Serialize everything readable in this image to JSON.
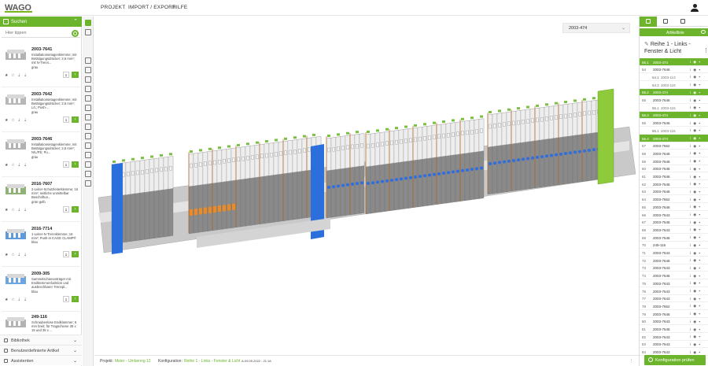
{
  "header": {
    "logo": "WAGO",
    "nav": [
      "PROJEKT",
      "IMPORT / EXPORT",
      "HILFE"
    ]
  },
  "left": {
    "title": "Suchen",
    "search_placeholder": "Hier tippen",
    "products": [
      {
        "code": "2003-7641",
        "desc": "Installationsetagenklemme; mit Betätigungsdrücker; 2,5 mm²; mit N-Trenn...",
        "color": "grau",
        "qty": "1"
      },
      {
        "code": "2003-7642",
        "desc": "Installationsetagenklemme; mit Betätigungsdrücker; 2,5 mm²; L/L; Push-...",
        "color": "grau",
        "qty": "1"
      },
      {
        "code": "2003-7646",
        "desc": "Installationsetagenklemme; mit Betätigungsdrücker; 2,5 mm²; N/L/PE; Pu...",
        "color": "grau",
        "qty": "1"
      },
      {
        "code": "2016-7607",
        "desc": "2-Leiter-Schutzleiterklemme; 16 mm²; seitliche unmittelbar Beschriftun...",
        "color": "grün-gelb",
        "qty": "1"
      },
      {
        "code": "2016-7714",
        "desc": "1-Leiter-N-Trennklemme; 16 mm²; Push-in CAGE CLAMP®",
        "color": "blau",
        "qty": "1"
      },
      {
        "code": "2009-305",
        "desc": "Sammelschienenträger mit Endklemmenfunktion und ausbrechbarer Trennpl...",
        "color": "blau",
        "qty": "1"
      },
      {
        "code": "249-116",
        "desc": "Schraubenlose Endklammer; 6 mm breit; für Tragschiene 35 x 15 und 35 x ...",
        "color": "",
        "qty": "1"
      }
    ],
    "sections": [
      "Bibliothek",
      "Benutzerdefinierte Artikel",
      "Assistenten"
    ]
  },
  "canvas": {
    "config_select": "2003-474"
  },
  "footer": {
    "project_label": "Projekt:",
    "project_value": "Meier - Umbenng 12",
    "config_label": "Konfiguration:",
    "config_value": "Reihe 1 - Links - Fenster & Licht",
    "date": "A-09.09.2022 - 21:18"
  },
  "right": {
    "subtitle": "Artikelliste",
    "title": "Reihe 1 - Links - Fenster & Licht",
    "rows": [
      {
        "n": "56.1",
        "c": "2003-474",
        "type": "g"
      },
      {
        "n": "54",
        "c": "2003-7646",
        "type": "n"
      },
      {
        "n": "54.1",
        "c": "2003-113",
        "type": "sub"
      },
      {
        "n": "54.2",
        "c": "2003-115",
        "type": "sub"
      },
      {
        "n": "56.2",
        "c": "2003-474",
        "type": "g"
      },
      {
        "n": "55",
        "c": "2003-7646",
        "type": "n"
      },
      {
        "n": "55.1",
        "c": "2003-115",
        "type": "sub"
      },
      {
        "n": "56.3",
        "c": "2003-474",
        "type": "g"
      },
      {
        "n": "56",
        "c": "2003-7646",
        "type": "n"
      },
      {
        "n": "56.1",
        "c": "2003-115",
        "type": "sub"
      },
      {
        "n": "56.4",
        "c": "2003-474",
        "type": "g"
      },
      {
        "n": "57",
        "c": "2003-7662",
        "type": "n"
      },
      {
        "n": "58",
        "c": "2003-7646",
        "type": "n"
      },
      {
        "n": "59",
        "c": "2003-7646",
        "type": "n"
      },
      {
        "n": "60",
        "c": "2003-7646",
        "type": "n"
      },
      {
        "n": "61",
        "c": "2003-7646",
        "type": "n"
      },
      {
        "n": "62",
        "c": "2003-7646",
        "type": "n"
      },
      {
        "n": "63",
        "c": "2003-7646",
        "type": "n"
      },
      {
        "n": "64",
        "c": "2003-7662",
        "type": "n"
      },
      {
        "n": "65",
        "c": "2003-7646",
        "type": "n"
      },
      {
        "n": "66",
        "c": "2003-7643",
        "type": "n"
      },
      {
        "n": "67",
        "c": "2003-7646",
        "type": "n"
      },
      {
        "n": "68",
        "c": "2003-7643",
        "type": "n"
      },
      {
        "n": "69",
        "c": "2003-7646",
        "type": "n"
      },
      {
        "n": "70",
        "c": "249-116",
        "type": "n"
      },
      {
        "n": "71",
        "c": "2003-7643",
        "type": "n"
      },
      {
        "n": "72",
        "c": "2003-7646",
        "type": "n"
      },
      {
        "n": "73",
        "c": "2003-7643",
        "type": "n"
      },
      {
        "n": "74",
        "c": "2003-7646",
        "type": "n"
      },
      {
        "n": "75",
        "c": "2003-7643",
        "type": "n"
      },
      {
        "n": "76",
        "c": "2003-7643",
        "type": "n"
      },
      {
        "n": "77",
        "c": "2003-7643",
        "type": "n"
      },
      {
        "n": "78",
        "c": "2003-7662",
        "type": "n"
      },
      {
        "n": "79",
        "c": "2003-7646",
        "type": "n"
      },
      {
        "n": "80",
        "c": "2003-7643",
        "type": "n"
      },
      {
        "n": "81",
        "c": "2003-7646",
        "type": "n"
      },
      {
        "n": "82",
        "c": "2003-7643",
        "type": "n"
      },
      {
        "n": "83",
        "c": "2003-7643",
        "type": "n"
      },
      {
        "n": "84",
        "c": "2003-7643",
        "type": "n"
      }
    ],
    "check_button": "Konfiguration prüfen"
  }
}
